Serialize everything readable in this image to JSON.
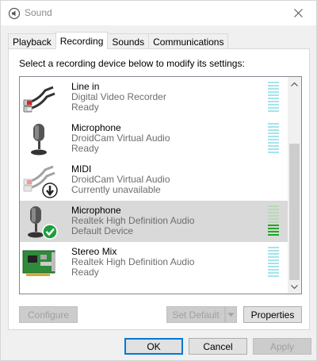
{
  "window": {
    "title": "Sound",
    "title_icon": "speaker-icon",
    "close_icon": "close-icon"
  },
  "tabs": [
    {
      "label": "Playback"
    },
    {
      "label": "Recording",
      "active": true
    },
    {
      "label": "Sounds"
    },
    {
      "label": "Communications"
    }
  ],
  "instruction": "Select a recording device below to modify its settings:",
  "devices": [
    {
      "name": "Line in",
      "description": "Digital Video Recorder",
      "status": "Ready",
      "icon": "line-in-cable-icon",
      "level": 0
    },
    {
      "name": "Microphone",
      "description": "DroidCam Virtual Audio",
      "status": "Ready",
      "icon": "microphone-icon",
      "level": 0
    },
    {
      "name": "MIDI",
      "description": "DroidCam Virtual Audio",
      "status": "Currently unavailable",
      "icon": "midi-cable-icon",
      "badge": "down-arrow-icon",
      "level": null
    },
    {
      "name": "Microphone",
      "description": "Realtek High Definition Audio",
      "status": "Default Device",
      "icon": "microphone-icon",
      "badge": "checkmark-icon",
      "selected": true,
      "level": 0.4
    },
    {
      "name": "Stereo Mix",
      "description": "Realtek High Definition Audio",
      "status": "Ready",
      "icon": "circuit-board-icon",
      "level": 0
    }
  ],
  "buttons": {
    "configure": "Configure",
    "set_default": "Set Default",
    "properties": "Properties",
    "ok": "OK",
    "cancel": "Cancel",
    "apply": "Apply"
  },
  "colors": {
    "accent": "#0078d7",
    "meter_idle": "#a4e4ec",
    "meter_active": "#1fa824",
    "selection": "#d9d9d9"
  }
}
